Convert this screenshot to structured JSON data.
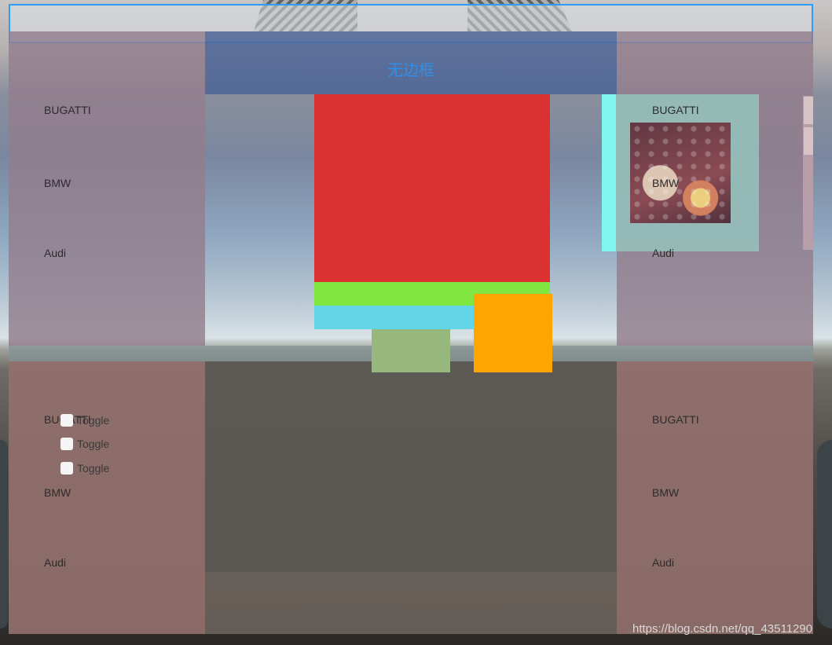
{
  "header": {
    "title": "无边框"
  },
  "lists": {
    "top_left": [
      "BUGATTI",
      "BMW",
      "Audi"
    ],
    "top_right": [
      "BUGATTI",
      "BMW",
      "Audi"
    ],
    "bottom_left": [
      "BUGATTI",
      "BMW",
      "Audi"
    ],
    "bottom_right": [
      "BUGATTI",
      "BMW",
      "Audi"
    ]
  },
  "toggles": [
    {
      "label": "Toggle",
      "checked": false
    },
    {
      "label": "Toggle",
      "checked": false
    },
    {
      "label": "Toggle",
      "checked": false
    }
  ],
  "colors": {
    "accent_border": "#2e9bff",
    "header_text": "#2f8fe8",
    "red_block": "#db3131",
    "green_block": "#80e642",
    "cyan_block": "#62d5e8",
    "olive_block": "#97b87d",
    "orange_block": "#ffa500",
    "teal_bar": "#7ff7f0"
  },
  "watermark": "https://blog.csdn.net/qq_43511290"
}
